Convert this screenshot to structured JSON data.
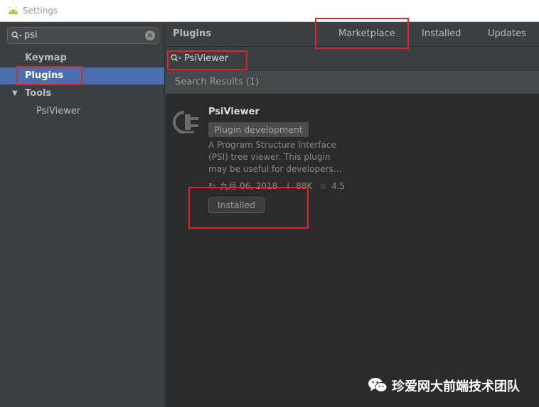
{
  "window": {
    "title": "Settings"
  },
  "sidebar": {
    "search_value": "psi",
    "items": [
      {
        "label": "Keymap"
      },
      {
        "label": "Plugins"
      },
      {
        "label": "Tools"
      },
      {
        "label": "PsiViewer"
      }
    ]
  },
  "main": {
    "title": "Plugins",
    "tabs": [
      {
        "label": "Marketplace"
      },
      {
        "label": "Installed"
      },
      {
        "label": "Updates"
      }
    ],
    "search_value": "PsiViewer",
    "results_header": "Search Results (1)",
    "plugin": {
      "name": "PsiViewer",
      "tag": "Plugin development",
      "description_lines": [
        "A Program Structure Interface",
        "(PSI) tree viewer. This plugin",
        "may be useful for developers…"
      ],
      "updated": "九月 06, 2018",
      "downloads": "88K",
      "rating": "4.5",
      "button_label": "Installed"
    }
  },
  "watermark": {
    "text": "珍爱网大前端技术团队"
  },
  "colors": {
    "selection": "#4b6eaf",
    "highlight_box": "#d9282d",
    "panel": "#3c3f41",
    "list_bg": "#2b2b2b"
  }
}
